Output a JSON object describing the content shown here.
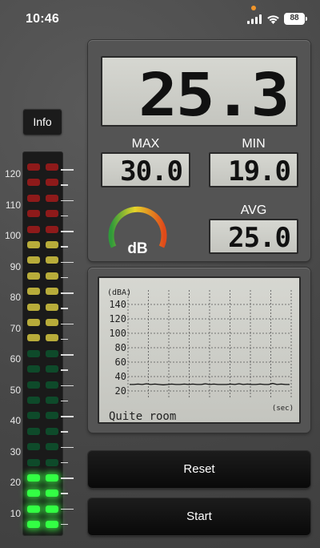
{
  "status_bar": {
    "time": "10:46",
    "battery": "88",
    "icons": [
      "signal-icon",
      "wifi-icon",
      "battery-icon"
    ],
    "indicator_color": "#f0952a"
  },
  "info_button": {
    "label": "Info"
  },
  "level_meter": {
    "scale_labels": [
      "120",
      "110",
      "100",
      "90",
      "80",
      "70",
      "60",
      "50",
      "40",
      "30",
      "20",
      "10"
    ],
    "current_level_db": 25.3,
    "colors": {
      "red": "#8e1a1a",
      "yellow": "#b8ac3a",
      "green_off": "#0e4a2a",
      "green_on": "#33ff44"
    }
  },
  "display": {
    "current": "25.3",
    "max_label": "MAX",
    "max_value": "30.0",
    "min_label": "MIN",
    "min_value": "19.0",
    "avg_label": "AVG",
    "avg_value": "25.0",
    "gauge_label": "dB"
  },
  "graph": {
    "unit": "(dBA)",
    "x_unit": "(sec)",
    "y_labels": [
      "140",
      "120",
      "100",
      "80",
      "60",
      "40",
      "20"
    ],
    "caption": "Quite room"
  },
  "chart_data": {
    "type": "line",
    "ylabel": "(dBA)",
    "xlabel": "(sec)",
    "ylim": [
      20,
      140
    ],
    "series": [
      {
        "values": [
          29,
          29,
          29.5,
          29,
          30,
          29,
          29.5,
          29,
          28.5,
          29,
          29.5,
          29,
          29,
          29.5,
          29,
          29.5,
          29,
          29,
          30,
          29,
          29.5,
          29,
          29,
          29,
          29.5,
          29,
          30,
          29,
          29.5,
          29,
          29,
          29.5,
          29,
          29,
          30.5,
          29,
          29.5,
          29,
          29
        ]
      }
    ],
    "grid": true
  },
  "buttons": {
    "reset": "Reset",
    "start": "Start"
  }
}
